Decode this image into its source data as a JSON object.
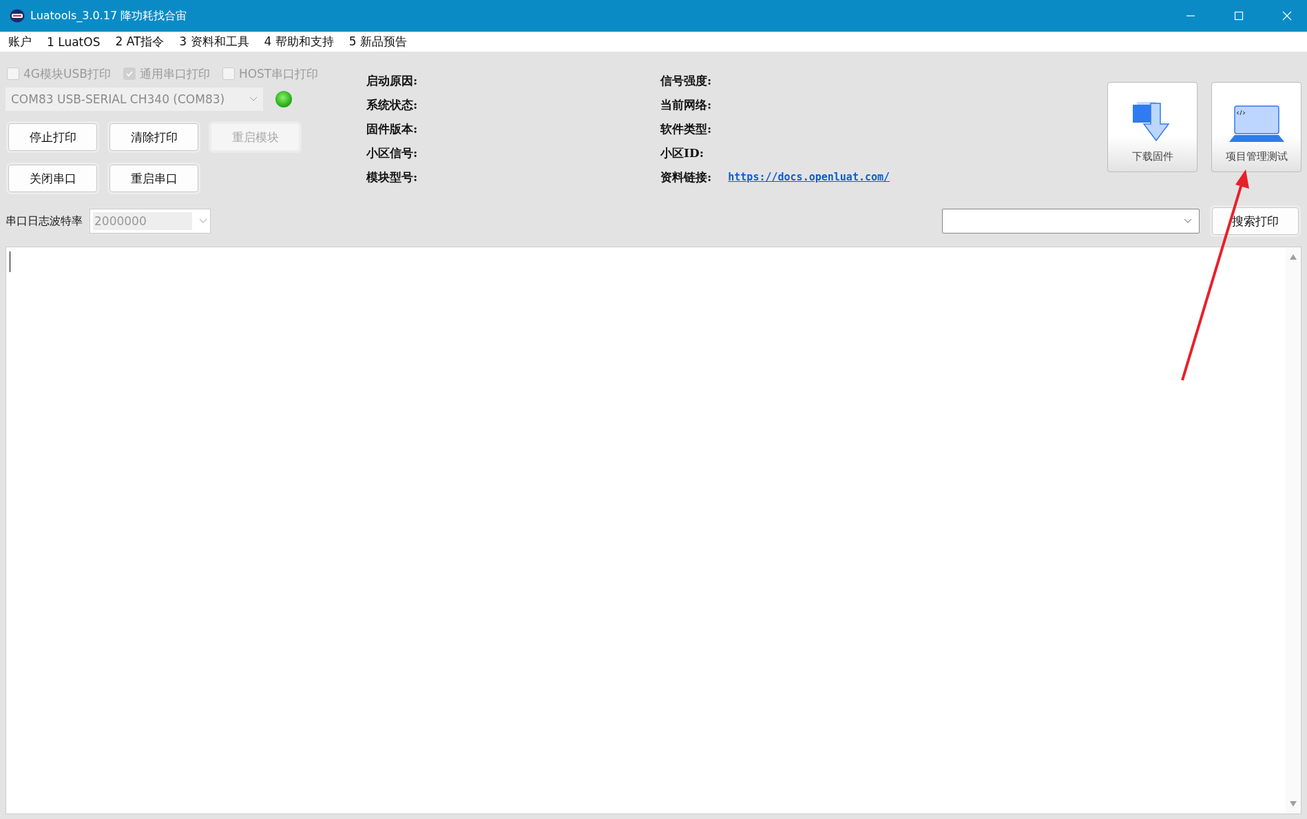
{
  "window": {
    "title": "Luatools_3.0.17 降功耗找合宙"
  },
  "menu": [
    "账户",
    "1 LuatOS",
    "2 AT指令",
    "3 资料和工具",
    "4 帮助和支持",
    "5 新品预告"
  ],
  "print_options": [
    {
      "label": "4G模块USB打印",
      "checked": false,
      "disabled": true
    },
    {
      "label": "通用串口打印",
      "checked": true,
      "disabled": true
    },
    {
      "label": "HOST串口打印",
      "checked": false,
      "disabled": true
    }
  ],
  "port": {
    "value": "COM83 USB-SERIAL CH340 (COM83)",
    "connected": true
  },
  "buttons": [
    [
      {
        "label": "停止打印",
        "disabled": false
      },
      {
        "label": "清除打印",
        "disabled": false
      },
      {
        "label": "重启模块",
        "disabled": true
      }
    ],
    [
      {
        "label": "关闭串口",
        "disabled": false
      },
      {
        "label": "重启串口",
        "disabled": false
      }
    ]
  ],
  "info_left": [
    "启动原因:",
    "系统状态:",
    "固件版本:",
    "小区信号:",
    "模块型号:"
  ],
  "info_right": [
    {
      "label": "信号强度:"
    },
    {
      "label": "当前网络:"
    },
    {
      "label": "软件类型:"
    },
    {
      "label": "小区ID:"
    },
    {
      "label": "资料链接:",
      "link": "https://docs.openluat.com/"
    }
  ],
  "tools": [
    {
      "kind": "download",
      "label": "下载固件"
    },
    {
      "kind": "project",
      "label": "项目管理测试"
    }
  ],
  "baud": {
    "label": "串口日志波特率",
    "value": "2000000"
  },
  "search": {
    "button": "搜索打印"
  }
}
